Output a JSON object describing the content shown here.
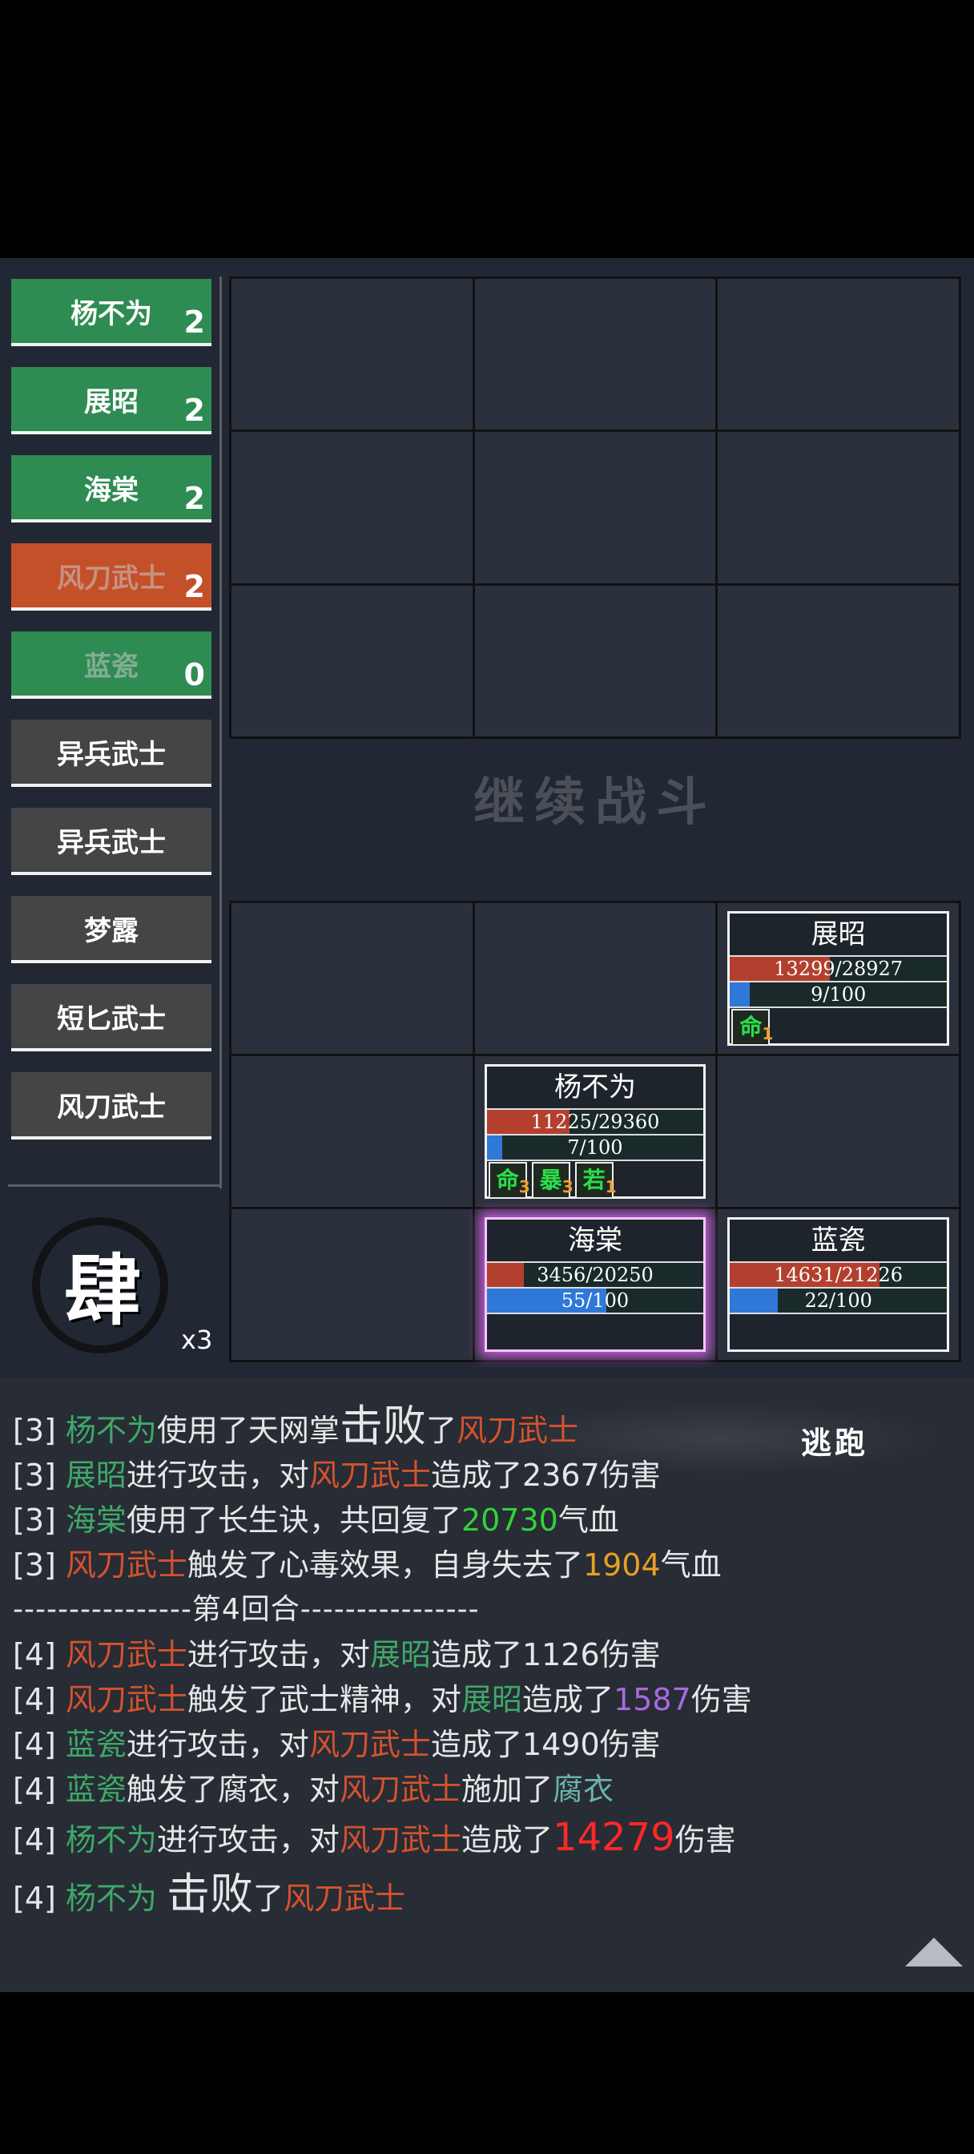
{
  "turn_order": [
    {
      "name": "杨不为",
      "count": "2",
      "style": "green",
      "dim": false
    },
    {
      "name": "展昭",
      "count": "2",
      "style": "green",
      "dim": false
    },
    {
      "name": "海棠",
      "count": "2",
      "style": "green",
      "dim": false
    },
    {
      "name": "风刀武士",
      "count": "2",
      "style": "orange",
      "dim": true
    },
    {
      "name": "蓝瓷",
      "count": "0",
      "style": "green",
      "dim": true
    },
    {
      "name": "异兵武士",
      "count": "",
      "style": "gray",
      "dim": false
    },
    {
      "name": "异兵武士",
      "count": "",
      "style": "gray",
      "dim": false
    },
    {
      "name": "梦露",
      "count": "",
      "style": "gray",
      "dim": false
    },
    {
      "name": "短匕武士",
      "count": "",
      "style": "gray",
      "dim": false
    },
    {
      "name": "风刀武士",
      "count": "",
      "style": "gray",
      "dim": false
    }
  ],
  "skill": {
    "glyph": "肆",
    "multiplier": "x3"
  },
  "continue_label": "继续战斗",
  "allies": [
    {
      "cell": 2,
      "name": "展昭",
      "hp_text": "13299/28927",
      "hp_frac": 0.46,
      "mp_text": "9/100",
      "mp_frac": 0.09,
      "buffs": [
        {
          "label": "命",
          "stack": "1"
        }
      ],
      "selected": false
    },
    {
      "cell": 4,
      "name": "杨不为",
      "hp_text": "11225/29360",
      "hp_frac": 0.38,
      "mp_text": "7/100",
      "mp_frac": 0.07,
      "buffs": [
        {
          "label": "命",
          "stack": "3"
        },
        {
          "label": "暴",
          "stack": "3"
        },
        {
          "label": "若",
          "stack": "1"
        }
      ],
      "selected": false
    },
    {
      "cell": 7,
      "name": "海棠",
      "hp_text": "3456/20250",
      "hp_frac": 0.17,
      "mp_text": "55/100",
      "mp_frac": 0.55,
      "buffs": [],
      "selected": true
    },
    {
      "cell": 8,
      "name": "蓝瓷",
      "hp_text": "14631/21226",
      "hp_frac": 0.69,
      "mp_text": "22/100",
      "mp_frac": 0.22,
      "buffs": [],
      "selected": false
    }
  ],
  "flee_label": "逃跑",
  "log": [
    {
      "cls": "",
      "parts": [
        [
          "[3] ",
          ""
        ],
        [
          "杨不为",
          "c-g"
        ],
        [
          "使用了天网掌",
          ""
        ],
        [
          "击败",
          "big"
        ],
        [
          "了",
          ""
        ],
        [
          "风刀武士",
          "c-o"
        ]
      ]
    },
    {
      "cls": "",
      "parts": [
        [
          "[3] ",
          ""
        ],
        [
          "展昭",
          "c-g"
        ],
        [
          "进行攻击，对",
          ""
        ],
        [
          "风刀武士",
          "c-o"
        ],
        [
          "造成了2367伤害",
          ""
        ]
      ]
    },
    {
      "cls": "",
      "parts": [
        [
          "[3] ",
          ""
        ],
        [
          "海棠",
          "c-g"
        ],
        [
          "使用了长生诀，共回复了",
          ""
        ],
        [
          "20730",
          "c-lg"
        ],
        [
          "气血",
          ""
        ]
      ]
    },
    {
      "cls": "",
      "parts": [
        [
          "[3] ",
          ""
        ],
        [
          "风刀武士",
          "c-o"
        ],
        [
          "触发了心毒效果，自身失去了",
          ""
        ],
        [
          "1904",
          "c-y"
        ],
        [
          "气血",
          ""
        ]
      ]
    },
    {
      "cls": "divline",
      "parts": [
        [
          "----------------第4回合----------------",
          ""
        ]
      ]
    },
    {
      "cls": "",
      "parts": [
        [
          "[4] ",
          ""
        ],
        [
          "风刀武士",
          "c-o"
        ],
        [
          "进行攻击，对",
          ""
        ],
        [
          "展昭",
          "c-g"
        ],
        [
          "造成了1126伤害",
          ""
        ]
      ]
    },
    {
      "cls": "",
      "parts": [
        [
          "[4] ",
          ""
        ],
        [
          "风刀武士",
          "c-o"
        ],
        [
          "触发了武士精神，对",
          ""
        ],
        [
          "展昭",
          "c-g"
        ],
        [
          "造成了",
          ""
        ],
        [
          "1587",
          "c-p"
        ],
        [
          "伤害",
          ""
        ]
      ]
    },
    {
      "cls": "",
      "parts": [
        [
          "[4] ",
          ""
        ],
        [
          "蓝瓷",
          "c-g"
        ],
        [
          "进行攻击，对",
          ""
        ],
        [
          "风刀武士",
          "c-o"
        ],
        [
          "造成了1490伤害",
          ""
        ]
      ]
    },
    {
      "cls": "",
      "parts": [
        [
          "[4] ",
          ""
        ],
        [
          "蓝瓷",
          "c-g"
        ],
        [
          "触发了腐衣，对",
          ""
        ],
        [
          "风刀武士",
          "c-o"
        ],
        [
          "施加了",
          ""
        ],
        [
          "腐衣",
          "c-t"
        ]
      ]
    },
    {
      "cls": "big",
      "parts": [
        [
          "[4] ",
          ""
        ],
        [
          "杨不为",
          "c-g"
        ],
        [
          "进行攻击，对",
          ""
        ],
        [
          "风刀武士",
          "c-o"
        ],
        [
          "造成了",
          ""
        ],
        [
          "14279",
          "c-r"
        ],
        [
          "伤害",
          ""
        ]
      ]
    },
    {
      "cls": "big",
      "parts": [
        [
          "[4] ",
          ""
        ],
        [
          "杨不为",
          "c-g"
        ],
        [
          "big-space",
          ""
        ],
        [
          "击败",
          "big"
        ],
        [
          "了",
          ""
        ],
        [
          "风刀武士",
          "c-o"
        ]
      ]
    }
  ]
}
